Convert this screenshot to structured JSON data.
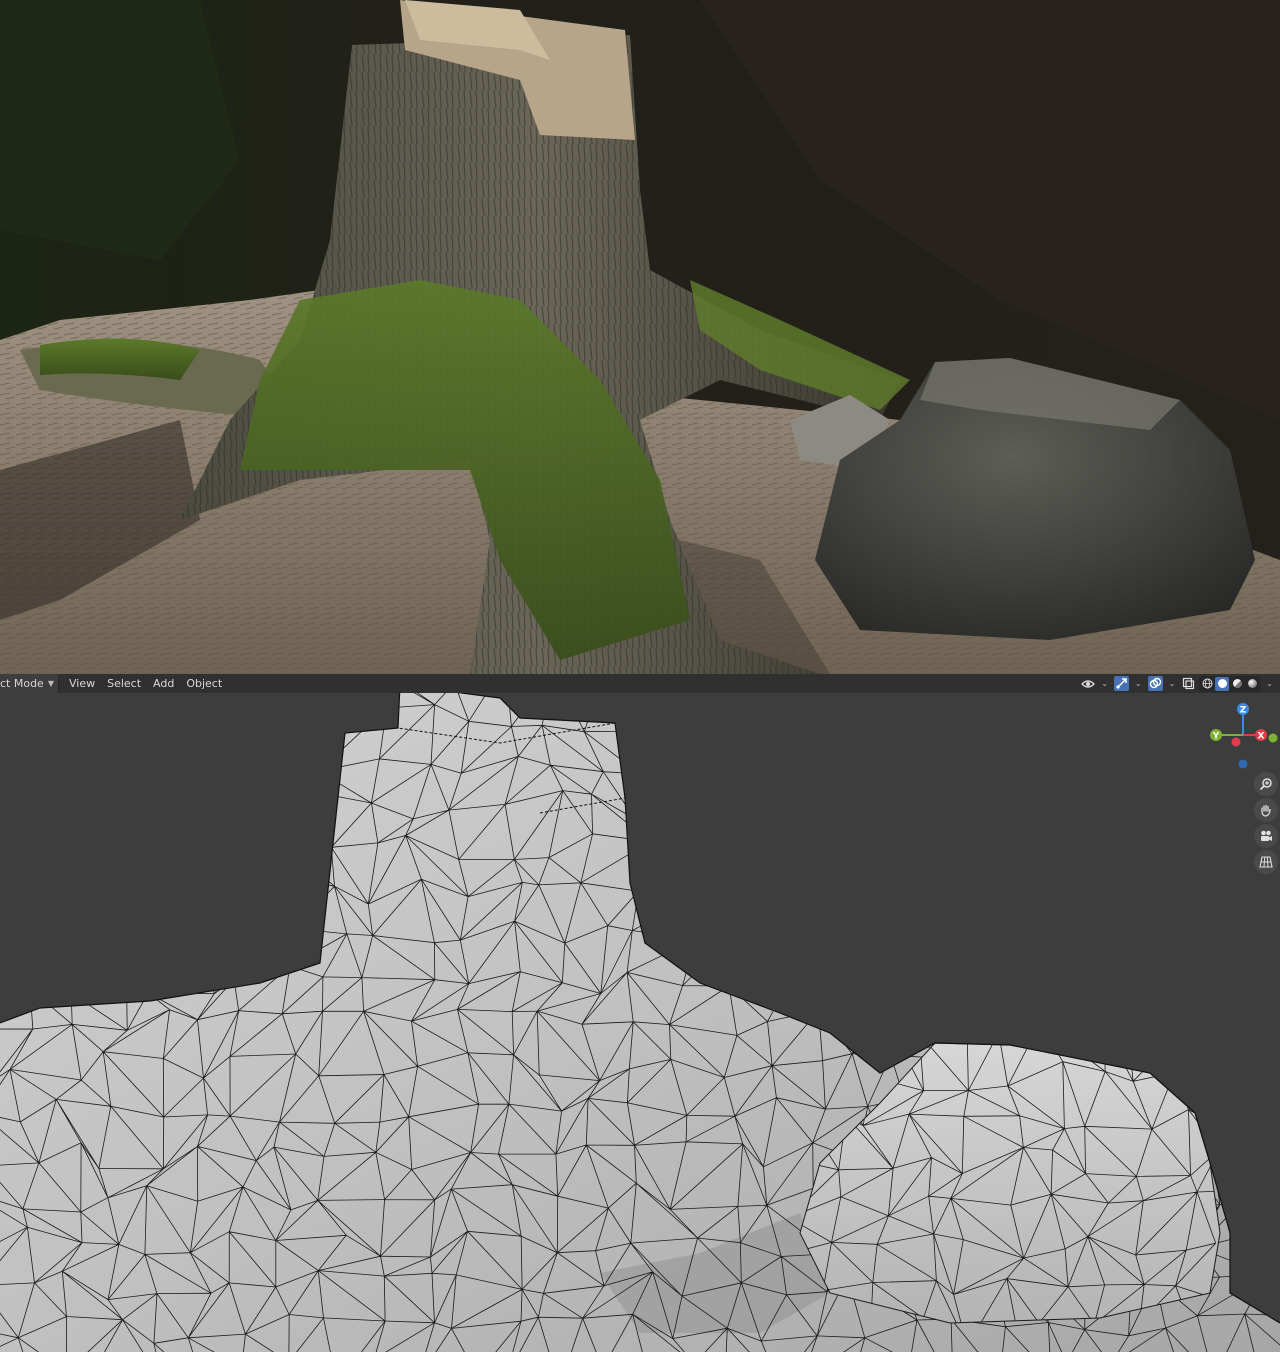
{
  "toolbar": {
    "mode_label": "ct Mode",
    "menus": [
      "View",
      "Select",
      "Add",
      "Object"
    ]
  },
  "gizmo": {
    "z_label": "Z",
    "y_label": "Y",
    "x_label": "X",
    "colors": {
      "x": "#e23b4a",
      "y": "#7fb232",
      "z": "#3a8be8"
    }
  },
  "icons": {
    "view_icon": "eye-icon",
    "snap_icon": "magnet-icon",
    "overlay_icon": "overlay-icon",
    "xray_icon": "xray-icon",
    "shading_wire": "wireframe-shading-icon",
    "shading_solid": "solid-shading-icon",
    "shading_material": "material-shading-icon",
    "shading_render": "rendered-shading-icon",
    "zoom": "zoom-icon",
    "pan": "hand-icon",
    "camera": "camera-icon",
    "grid": "grid-icon"
  },
  "colors": {
    "accent": "#4772b3",
    "viewport_bg": "#3d3d3d",
    "header_bg": "#303030"
  }
}
